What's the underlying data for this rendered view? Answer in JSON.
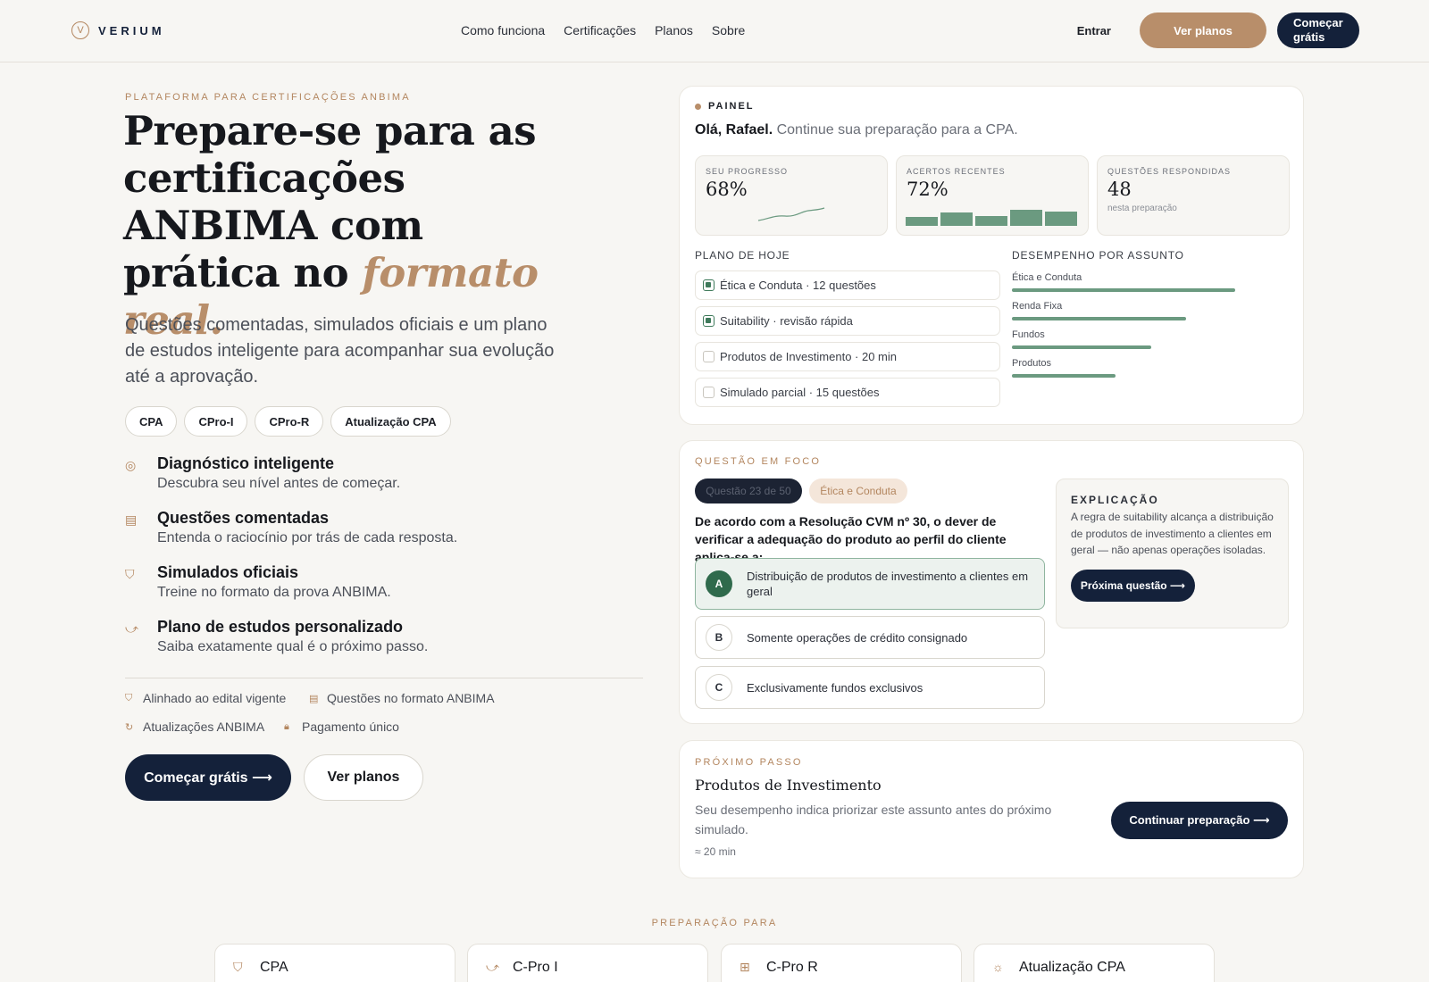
{
  "brand": {
    "logo_letter": "V",
    "name": "VERIUM"
  },
  "nav": [
    "Como funciona",
    "Certificações",
    "Planos",
    "Sobre"
  ],
  "header_actions": {
    "login": "Entrar",
    "plans": "Ver planos",
    "start": "Começar grátis"
  },
  "hero": {
    "eyebrow": "PLATAFORMA PARA CERTIFICAÇÕES ANBIMA",
    "title_main": "Prepare-se para as certificações ANBIMA com prática no ",
    "title_accent": "formato real.",
    "subtitle": "Questões comentadas, simulados oficiais e um plano de estudos inteligente para acompanhar sua evolução até a aprovação.",
    "pills": [
      "CPA",
      "CPro-I",
      "CPro-R",
      "Atualização CPA"
    ],
    "features": [
      {
        "icon": "target-icon",
        "title": "Diagnóstico inteligente",
        "desc": "Descubra seu nível antes de começar."
      },
      {
        "icon": "comment-icon",
        "title": "Questões comentadas",
        "desc": "Entenda o raciocínio por trás de cada resposta."
      },
      {
        "icon": "shield-icon",
        "title": "Simulados oficiais",
        "desc": "Treine no formato da prova ANBIMA."
      },
      {
        "icon": "trend-icon",
        "title": "Plano de estudos personalizado",
        "desc": "Saiba exatamente qual é o próximo passo."
      }
    ],
    "trust": [
      "Alinhado ao edital vigente",
      "Questões no formato ANBIMA",
      "Atualizações ANBIMA",
      "Pagamento único"
    ],
    "cta_primary": "Começar grátis ⟶",
    "cta_secondary": "Ver planos"
  },
  "panel": {
    "tag": "PAINEL",
    "greeting_name": "Olá, Rafael.",
    "greeting_text": " Continue sua preparação para a CPA.",
    "stats": [
      {
        "label": "SEU PROGRESSO",
        "value": "68%"
      },
      {
        "label": "ACERTOS RECENTES",
        "value": "72%"
      },
      {
        "label": "QUESTÕES RESPONDIDAS",
        "value": "48",
        "note": "nesta preparação"
      }
    ],
    "today_label": "PLANO DE HOJE",
    "today": [
      {
        "text": "Ética e Conduta · 12 questões",
        "done": true
      },
      {
        "text": "Suitability · revisão rápida",
        "done": true
      },
      {
        "text": "Produtos de Investimento · 20 min",
        "done": false
      },
      {
        "text": "Simulado parcial · 15 questões",
        "done": false
      }
    ],
    "performance_label": "DESEMPENHO POR ASSUNTO",
    "performance": [
      {
        "subject": "Ética e Conduta",
        "level": 0.82
      },
      {
        "subject": "Renda Fixa",
        "level": 0.64
      },
      {
        "subject": "Fundos",
        "level": 0.51
      },
      {
        "subject": "Produtos",
        "level": 0.38
      }
    ],
    "accent_green": "#6b9a80"
  },
  "question": {
    "label": "QUESTÃO EM FOCO",
    "counter": "Questão 23 de 50",
    "topic": "Ética e Conduta",
    "text": "De acordo com a Resolução CVM nº 30, o dever de verificar a adequação do produto ao perfil do cliente aplica-se a:",
    "options": [
      {
        "letter": "A",
        "text": "Distribuição de produtos de investimento a clientes em geral",
        "selected": true
      },
      {
        "letter": "B",
        "text": "Somente operações de crédito consignado",
        "selected": false
      },
      {
        "letter": "C",
        "text": "Exclusivamente fundos exclusivos",
        "selected": false
      }
    ],
    "explanation_title": "EXPLICAÇÃO",
    "explanation": "A regra de suitability alcança a distribuição de produtos de investimento a clientes em geral — não apenas operações isoladas.",
    "next_button": "Próxima questão ⟶"
  },
  "next_step": {
    "label": "PRÓXIMO PASSO",
    "title": "Produtos de Investimento",
    "desc": "Seu desempenho indica priorizar este assunto antes do próximo simulado.",
    "time": "≈ 20 min",
    "button": "Continuar preparação ⟶"
  },
  "prep": {
    "label": "PREPARAÇÃO PARA",
    "certs": [
      {
        "icon": "shield-icon",
        "name": "CPA"
      },
      {
        "icon": "trend-icon",
        "name": "C-Pro I"
      },
      {
        "icon": "plus-square-icon",
        "name": "C-Pro R"
      },
      {
        "icon": "sun-icon",
        "name": "Atualização CPA"
      }
    ]
  }
}
